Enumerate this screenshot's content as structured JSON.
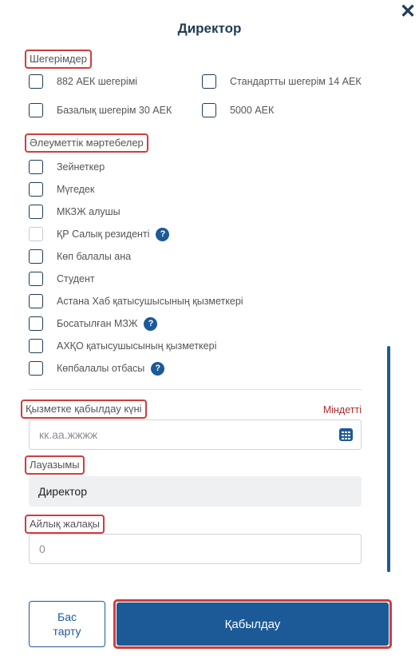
{
  "dialog": {
    "title": "Директор",
    "close": "✕"
  },
  "deductions": {
    "label": "Шегерімдер",
    "items": [
      "882 АЕК шегерімі",
      "Стандартты шегерім 14 АЕК",
      "Базалық шегерім 30 АЕК",
      "5000 АЕК"
    ]
  },
  "social": {
    "label": "Әлеуметтік мәртебелер",
    "items": [
      {
        "label": "Зейнеткер",
        "help": false,
        "disabled": false
      },
      {
        "label": "Мүгедек",
        "help": false,
        "disabled": false
      },
      {
        "label": "МКЗЖ алушы",
        "help": false,
        "disabled": false
      },
      {
        "label": "ҚР Салық резиденті",
        "help": true,
        "disabled": true
      },
      {
        "label": "Көп балалы ана",
        "help": false,
        "disabled": false
      },
      {
        "label": "Студент",
        "help": false,
        "disabled": false
      },
      {
        "label": "Астана Хаб қатысушысының қызметкері",
        "help": false,
        "disabled": false
      },
      {
        "label": "Босатылған МЗЖ",
        "help": true,
        "disabled": false
      },
      {
        "label": "АХҚО қатысушысының қызметкері",
        "help": false,
        "disabled": false
      },
      {
        "label": "Көпбалалы отбасы",
        "help": true,
        "disabled": false
      }
    ]
  },
  "hire_date": {
    "label": "Қызметке қабылдау күні",
    "required": "Міндетті",
    "placeholder": "кк.аа.жжжж"
  },
  "position": {
    "label": "Лауазымы",
    "value": "Директор"
  },
  "salary": {
    "label": "Айлық жалақы",
    "placeholder": "0"
  },
  "help_glyph": "?",
  "buttons": {
    "cancel": "Бас тарту",
    "accept": "Қабылдау"
  },
  "colors": {
    "primary": "#1c5a97",
    "highlight": "#d13c3c",
    "required": "#b22a2a"
  }
}
